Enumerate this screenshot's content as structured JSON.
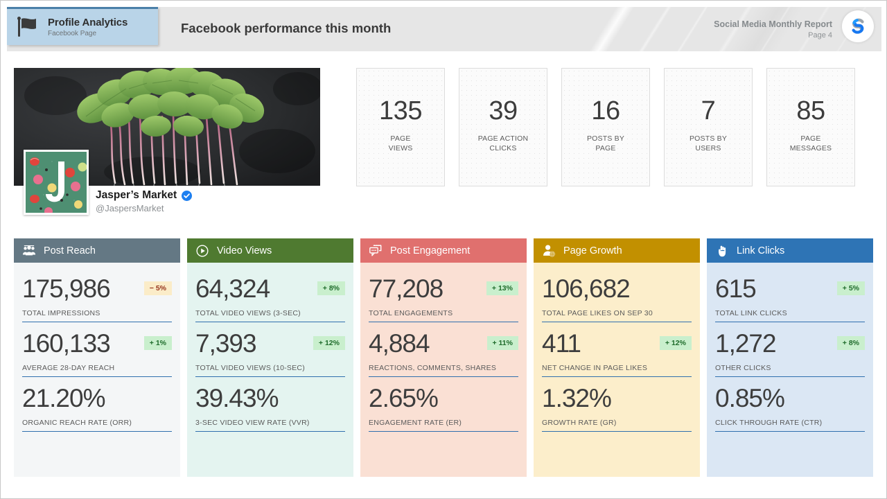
{
  "header": {
    "badge": {
      "icon": "flag-icon",
      "title": "Profile Analytics",
      "subtitle": "Facebook Page"
    },
    "title": "Facebook performance this month",
    "report_name": "Social Media Monthly Report",
    "page_label": "Page 4",
    "logo_icon": "brand-s-logo-icon",
    "background_color": "#e6e6e6",
    "badge_color": "#b9d4e8"
  },
  "profile": {
    "cover_image": "radish-greens-on-dark-slate-photo",
    "avatar_image": "jaspers-market-j-logo-with-fruit",
    "name": "Jasper’s Market",
    "handle": "@JaspersMarket",
    "verified": true,
    "verified_icon": "verified-check-icon"
  },
  "kpi_tiles": [
    {
      "value": "135",
      "label": "PAGE\nVIEWS"
    },
    {
      "value": "39",
      "label": "PAGE ACTION\nCLICKS"
    },
    {
      "value": "16",
      "label": "POSTS BY\nPAGE"
    },
    {
      "value": "7",
      "label": "POSTS BY\nUSERS"
    },
    {
      "value": "85",
      "label": "PAGE\nMESSAGES"
    }
  ],
  "panels": [
    {
      "title": "Post Reach",
      "icon": "people-group-icon",
      "header_color": "#647884",
      "body_color": "#f4f6f7",
      "metrics": [
        {
          "value": "175,986",
          "label": "TOTAL IMPRESSIONS",
          "badge": "− 5%",
          "badge_dir": "down"
        },
        {
          "value": "160,133",
          "label": "AVERAGE 28-DAY REACH",
          "badge": "+ 1%",
          "badge_dir": "up"
        },
        {
          "value": "21.20%",
          "label": "ORGANIC REACH RATE (ORR)",
          "badge": "",
          "badge_dir": "none"
        }
      ]
    },
    {
      "title": "Video Views",
      "icon": "play-circle-icon",
      "header_color": "#4f7a30",
      "body_color": "#e4f4f0",
      "metrics": [
        {
          "value": "64,324",
          "label": "TOTAL VIDEO VIEWS (3-SEC)",
          "badge": "+ 8%",
          "badge_dir": "up"
        },
        {
          "value": "7,393",
          "label": "TOTAL VIDEO VIEWS (10-SEC)",
          "badge": "+ 12%",
          "badge_dir": "up"
        },
        {
          "value": "39.43%",
          "label": "3-SEC VIDEO VIEW RATE (VVR)",
          "badge": "",
          "badge_dir": "none"
        }
      ]
    },
    {
      "title": "Post Engagement",
      "icon": "comment-bubble-icon",
      "header_color": "#e0706e",
      "body_color": "#fae0d4",
      "metrics": [
        {
          "value": "77,208",
          "label": "TOTAL ENGAGEMENTS",
          "badge": "+ 13%",
          "badge_dir": "up"
        },
        {
          "value": "4,884",
          "label": "REACTIONS, COMMENTS, SHARES",
          "badge": "+ 11%",
          "badge_dir": "up"
        },
        {
          "value": "2.65%",
          "label": "ENGAGEMENT RATE (ER)",
          "badge": "",
          "badge_dir": "none"
        }
      ]
    },
    {
      "title": "Page Growth",
      "icon": "user-plus-icon",
      "header_color": "#c29000",
      "body_color": "#fceecb",
      "metrics": [
        {
          "value": "106,682",
          "label": "TOTAL PAGE LIKES ON SEP 30",
          "badge": "",
          "badge_dir": "none"
        },
        {
          "value": "411",
          "label": "NET CHANGE IN PAGE LIKES",
          "badge": "+ 12%",
          "badge_dir": "up"
        },
        {
          "value": "1.32%",
          "label": "GROWTH RATE (GR)",
          "badge": "",
          "badge_dir": "none"
        }
      ]
    },
    {
      "title": "Link Clicks",
      "icon": "pointing-hand-icon",
      "header_color": "#2e74b5",
      "body_color": "#dbe7f4",
      "metrics": [
        {
          "value": "615",
          "label": "TOTAL LINK CLICKS",
          "badge": "+ 5%",
          "badge_dir": "up"
        },
        {
          "value": "1,272",
          "label": "OTHER CLICKS",
          "badge": "+ 8%",
          "badge_dir": "up"
        },
        {
          "value": "0.85%",
          "label": "CLICK THROUGH RATE (CTR)",
          "badge": "",
          "badge_dir": "none"
        }
      ]
    }
  ],
  "colors": {
    "rule": "#2f6fae",
    "badge_up_bg": "#c9efcd",
    "badge_up_text": "#1e6b2a",
    "badge_down_bg": "#fbecc8",
    "badge_down_text": "#96341d"
  }
}
